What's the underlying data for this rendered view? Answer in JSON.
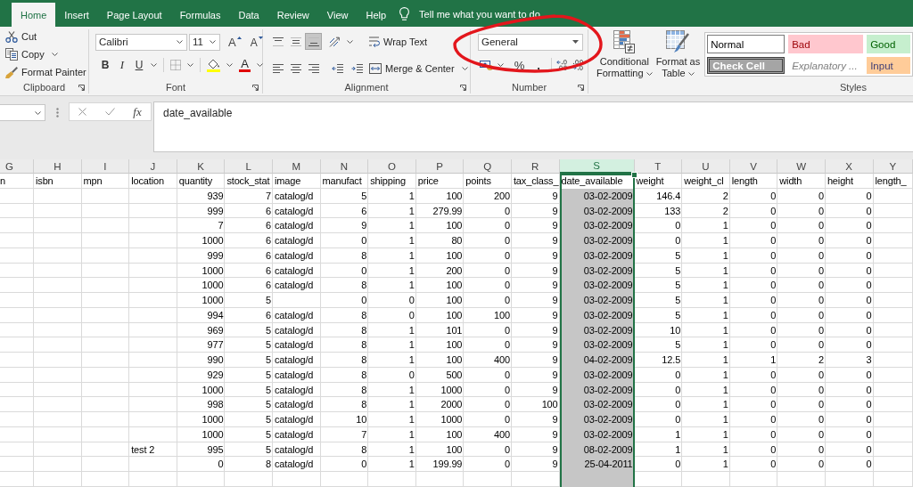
{
  "tabs": [
    {
      "label": "Home",
      "selected": true
    },
    {
      "label": "Insert",
      "selected": false
    },
    {
      "label": "Page Layout",
      "selected": false
    },
    {
      "label": "Formulas",
      "selected": false
    },
    {
      "label": "Data",
      "selected": false
    },
    {
      "label": "Review",
      "selected": false
    },
    {
      "label": "View",
      "selected": false
    },
    {
      "label": "Help",
      "selected": false
    }
  ],
  "tell_me": {
    "label": "Tell me what you want to do"
  },
  "clipboard": {
    "title": "Clipboard",
    "commands": [
      {
        "kind": "cut",
        "label": "Cut"
      },
      {
        "kind": "copy",
        "label": "Copy"
      },
      {
        "kind": "format_painter",
        "label": "Format Painter"
      }
    ]
  },
  "font": {
    "title": "Font",
    "font_name": "Calibri",
    "font_size": "11",
    "grow_font": "A",
    "shrink_font": "A",
    "bold": "B",
    "italic": "I",
    "underline": "U",
    "font_color": "A"
  },
  "alignment": {
    "title": "Alignment",
    "vertical": [
      {
        "kind": "top",
        "selected": false
      },
      {
        "kind": "middle",
        "selected": false
      },
      {
        "kind": "bottom",
        "selected": true
      }
    ],
    "horizontal": [
      {
        "kind": "left",
        "selected": false
      },
      {
        "kind": "center",
        "selected": false
      },
      {
        "kind": "right",
        "selected": false
      }
    ],
    "wrap_text": "Wrap Text",
    "merge": "Merge & Center"
  },
  "number": {
    "title": "Number",
    "format": "General",
    "percent": "%",
    "comma": ","
  },
  "styles": {
    "title": "Styles",
    "conditional_formatting": [
      "Conditional",
      "Formatting"
    ],
    "format_as_table": [
      "Format as",
      "Table"
    ],
    "gallery": [
      {
        "kind": "normal",
        "label": "Normal"
      },
      {
        "kind": "bad",
        "label": "Bad"
      },
      {
        "kind": "good",
        "label": "Good"
      },
      {
        "kind": "check",
        "label": "Check Cell"
      },
      {
        "kind": "explanatory",
        "label": "Explanatory ..."
      },
      {
        "kind": "input",
        "label": "Input"
      }
    ]
  },
  "formula_bar": {
    "function_label": "fx",
    "value": "date_available"
  },
  "sheet": {
    "columns": [
      {
        "letter": "G",
        "selected": false
      },
      {
        "letter": "H",
        "selected": false
      },
      {
        "letter": "I",
        "selected": false
      },
      {
        "letter": "J",
        "selected": false
      },
      {
        "letter": "K",
        "selected": false
      },
      {
        "letter": "L",
        "selected": false
      },
      {
        "letter": "M",
        "selected": false
      },
      {
        "letter": "N",
        "selected": false
      },
      {
        "letter": "O",
        "selected": false
      },
      {
        "letter": "P",
        "selected": false
      },
      {
        "letter": "Q",
        "selected": false
      },
      {
        "letter": "R",
        "selected": false
      },
      {
        "letter": "S",
        "selected": true
      },
      {
        "letter": "T",
        "selected": false
      },
      {
        "letter": "U",
        "selected": false
      },
      {
        "letter": "V",
        "selected": false
      },
      {
        "letter": "W",
        "selected": false
      },
      {
        "letter": "X",
        "selected": false
      },
      {
        "letter": "Y",
        "selected": false
      }
    ],
    "rows": [
      [
        "n",
        "isbn",
        "mpn",
        "location",
        "quantity",
        "stock_stat",
        "image",
        "manufact",
        "shipping",
        "price",
        "points",
        "tax_class_",
        "date_available",
        "weight",
        "weight_cl",
        "length",
        "width",
        "height",
        "length_"
      ],
      [
        null,
        null,
        null,
        null,
        "939",
        "7",
        "catalog/d",
        "5",
        "1",
        "100",
        "200",
        "9",
        "03-02-2009",
        "146.4",
        "2",
        "0",
        "0",
        "0",
        null
      ],
      [
        null,
        null,
        null,
        null,
        "999",
        "6",
        "catalog/d",
        "6",
        "1",
        "279.99",
        "0",
        "9",
        "03-02-2009",
        "133",
        "2",
        "0",
        "0",
        "0",
        null
      ],
      [
        null,
        null,
        null,
        null,
        "7",
        "6",
        "catalog/d",
        "9",
        "1",
        "100",
        "0",
        "9",
        "03-02-2009",
        "0",
        "1",
        "0",
        "0",
        "0",
        null
      ],
      [
        null,
        null,
        null,
        null,
        "1000",
        "6",
        "catalog/d",
        "0",
        "1",
        "80",
        "0",
        "9",
        "03-02-2009",
        "0",
        "1",
        "0",
        "0",
        "0",
        null
      ],
      [
        null,
        null,
        null,
        null,
        "999",
        "6",
        "catalog/d",
        "8",
        "1",
        "100",
        "0",
        "9",
        "03-02-2009",
        "5",
        "1",
        "0",
        "0",
        "0",
        null
      ],
      [
        null,
        null,
        null,
        null,
        "1000",
        "6",
        "catalog/d",
        "0",
        "1",
        "200",
        "0",
        "9",
        "03-02-2009",
        "5",
        "1",
        "0",
        "0",
        "0",
        null
      ],
      [
        null,
        null,
        null,
        null,
        "1000",
        "6",
        "catalog/d",
        "8",
        "1",
        "100",
        "0",
        "9",
        "03-02-2009",
        "5",
        "1",
        "0",
        "0",
        "0",
        null
      ],
      [
        null,
        null,
        null,
        null,
        "1000",
        "5",
        null,
        "0",
        "0",
        "100",
        "0",
        "9",
        "03-02-2009",
        "5",
        "1",
        "0",
        "0",
        "0",
        null
      ],
      [
        null,
        null,
        null,
        null,
        "994",
        "6",
        "catalog/d",
        "8",
        "0",
        "100",
        "100",
        "9",
        "03-02-2009",
        "5",
        "1",
        "0",
        "0",
        "0",
        null
      ],
      [
        null,
        null,
        null,
        null,
        "969",
        "5",
        "catalog/d",
        "8",
        "1",
        "101",
        "0",
        "9",
        "03-02-2009",
        "10",
        "1",
        "0",
        "0",
        "0",
        null
      ],
      [
        null,
        null,
        null,
        null,
        "977",
        "5",
        "catalog/d",
        "8",
        "1",
        "100",
        "0",
        "9",
        "03-02-2009",
        "5",
        "1",
        "0",
        "0",
        "0",
        null
      ],
      [
        null,
        null,
        null,
        null,
        "990",
        "5",
        "catalog/d",
        "8",
        "1",
        "100",
        "400",
        "9",
        "04-02-2009",
        "12.5",
        "1",
        "1",
        "2",
        "3",
        null
      ],
      [
        null,
        null,
        null,
        null,
        "929",
        "5",
        "catalog/d",
        "8",
        "0",
        "500",
        "0",
        "9",
        "03-02-2009",
        "0",
        "1",
        "0",
        "0",
        "0",
        null
      ],
      [
        null,
        null,
        null,
        null,
        "1000",
        "5",
        "catalog/d",
        "8",
        "1",
        "1000",
        "0",
        "9",
        "03-02-2009",
        "0",
        "1",
        "0",
        "0",
        "0",
        null
      ],
      [
        null,
        null,
        null,
        null,
        "998",
        "5",
        "catalog/d",
        "8",
        "1",
        "2000",
        "0",
        "100",
        "03-02-2009",
        "0",
        "1",
        "0",
        "0",
        "0",
        null
      ],
      [
        null,
        null,
        null,
        null,
        "1000",
        "5",
        "catalog/d",
        "10",
        "1",
        "1000",
        "0",
        "9",
        "03-02-2009",
        "0",
        "1",
        "0",
        "0",
        "0",
        null
      ],
      [
        null,
        null,
        null,
        null,
        "1000",
        "5",
        "catalog/d",
        "7",
        "1",
        "100",
        "400",
        "9",
        "03-02-2009",
        "1",
        "1",
        "0",
        "0",
        "0",
        null
      ],
      [
        null,
        null,
        null,
        "test 2",
        "995",
        "5",
        "catalog/d",
        "8",
        "1",
        "100",
        "0",
        "9",
        "08-02-2009",
        "1",
        "1",
        "0",
        "0",
        "0",
        null
      ],
      [
        null,
        null,
        null,
        null,
        "0",
        "8",
        "catalog/d",
        "0",
        "1",
        "199.99",
        "0",
        "9",
        "25-04-2011",
        "0",
        "1",
        "0",
        "0",
        "0",
        null
      ]
    ]
  },
  "annotations": [
    {
      "kind": "ellipse"
    }
  ]
}
